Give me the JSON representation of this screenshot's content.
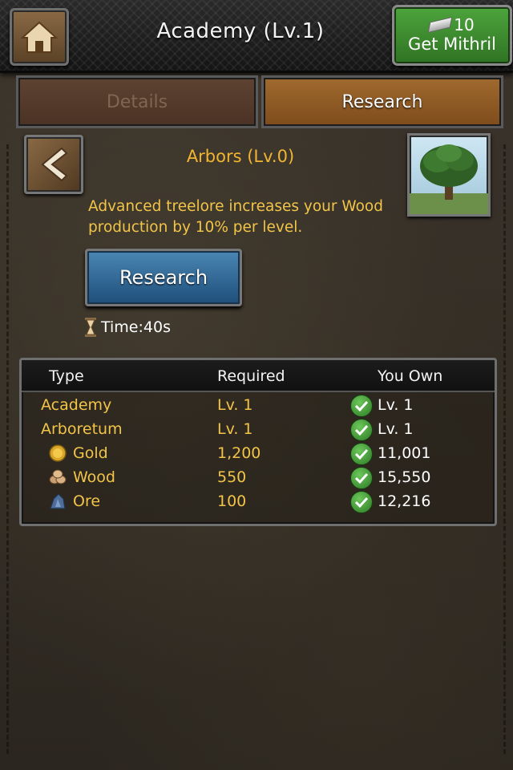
{
  "header": {
    "title": "Academy (Lv.1)",
    "mithril_count": "10",
    "mithril_label": "Get Mithril"
  },
  "tabs": [
    {
      "label": "Details",
      "active": false
    },
    {
      "label": "Research",
      "active": true
    }
  ],
  "research": {
    "title": "Arbors (Lv.0)",
    "description": "Advanced treelore increases your Wood production by 10% per level.",
    "button_label": "Research",
    "time_text": "Time:40s"
  },
  "table": {
    "headers": [
      "Type",
      "Required",
      "You Own"
    ],
    "rows": [
      {
        "type": "Academy",
        "required": "Lv. 1",
        "own": "Lv. 1",
        "icon": ""
      },
      {
        "type": "Arboretum",
        "required": "Lv. 1",
        "own": "Lv. 1",
        "icon": ""
      },
      {
        "type": "Gold",
        "required": "1,200",
        "own": "11,001",
        "icon": "gold-icon"
      },
      {
        "type": "Wood",
        "required": "550",
        "own": "15,550",
        "icon": "wood-icon"
      },
      {
        "type": "Ore",
        "required": "100",
        "own": "12,216",
        "icon": "ore-icon"
      }
    ]
  },
  "colors": {
    "accent_gold": "#f2b531",
    "text_yellow": "#f2c448",
    "mithril_green": "#3f8f31",
    "research_blue": "#2f6a99"
  }
}
